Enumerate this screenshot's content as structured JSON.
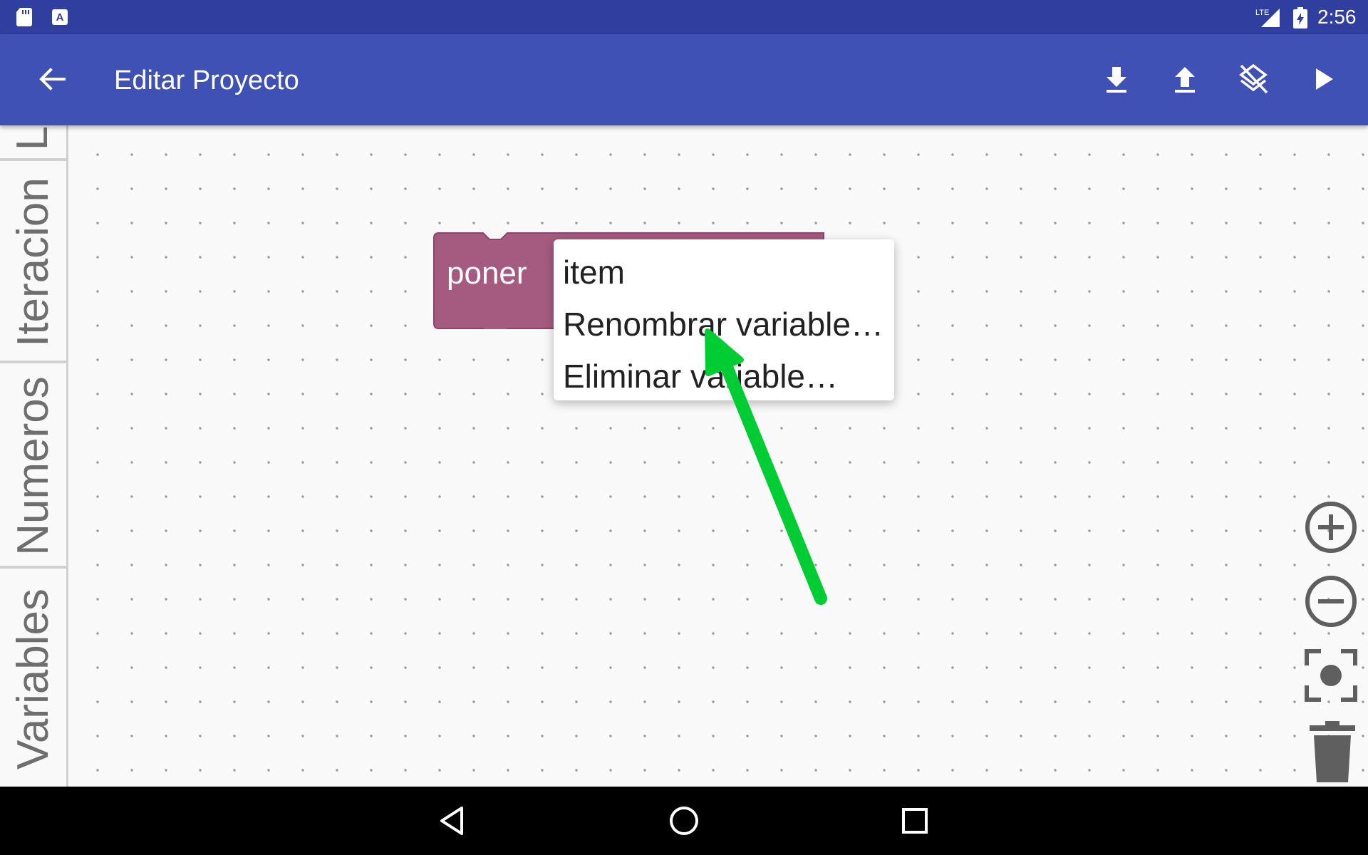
{
  "status_bar": {
    "time": "2:56",
    "network": "LTE",
    "icons": [
      "sd-card-icon",
      "app-notification-icon",
      "signal-icon",
      "battery-icon"
    ]
  },
  "app_bar": {
    "title": "Editar Proyecto",
    "actions": [
      "download-icon",
      "upload-icon",
      "clear-layers-icon",
      "run-icon"
    ]
  },
  "toolbox": {
    "tabs": [
      "L",
      "Iteracion",
      "Numeros",
      "Variables"
    ]
  },
  "block": {
    "label": "poner",
    "color": "#a55b80"
  },
  "dropdown_menu": {
    "items": [
      "item",
      "Renombrar variable…",
      "Eliminar variable…"
    ]
  },
  "workspace_controls": [
    "zoom-in-icon",
    "zoom-out-icon",
    "recenter-icon",
    "trash-icon"
  ],
  "annotation": {
    "arrow_color": "#00cc33"
  },
  "colors": {
    "status_bar": "#303f9f",
    "app_bar": "#3f51b5",
    "workspace": "#f9f9f9"
  }
}
